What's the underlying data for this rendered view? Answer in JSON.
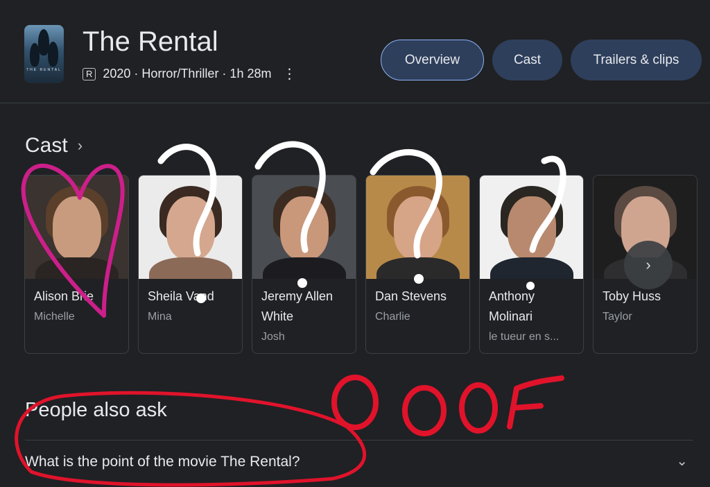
{
  "header": {
    "title": "The Rental",
    "rating": "R",
    "meta": "2020 · Horror/Thriller · 1h 28m",
    "poster_text": "THE RENTAL",
    "menu_icon": "more-vert-icon"
  },
  "tabs": [
    {
      "label": "Overview",
      "active": true
    },
    {
      "label": "Cast",
      "active": false
    },
    {
      "label": "Trailers & clips",
      "active": false
    }
  ],
  "cast": {
    "heading": "Cast",
    "chevron_icon": "chevron-right-icon",
    "members": [
      {
        "name": "Alison Brie",
        "role": "Michelle"
      },
      {
        "name": "Sheila Vand",
        "role": "Mina"
      },
      {
        "name": "Jeremy Allen White",
        "role": "Josh"
      },
      {
        "name": "Dan Stevens",
        "role": "Charlie"
      },
      {
        "name": "Anthony Molinari",
        "role": "le tueur en s..."
      },
      {
        "name": "Toby Huss",
        "role": "Taylor"
      }
    ],
    "next_icon": "chevron-right-icon"
  },
  "people_also_ask": {
    "heading": "People also ask",
    "question": "What is the point of the movie The Rental?",
    "expand_icon": "chevron-down-icon"
  },
  "annotations": {
    "text": "OOOF",
    "colors": {
      "heart": "#cc1f8a",
      "red": "#e0132b",
      "question": "#ffffff"
    }
  }
}
